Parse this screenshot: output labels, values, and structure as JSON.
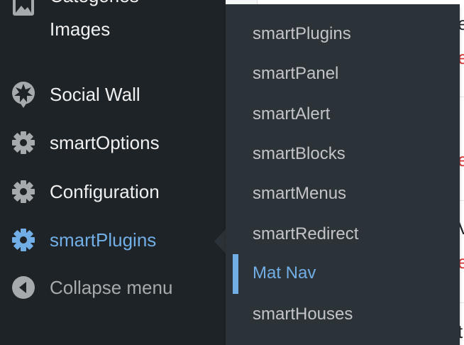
{
  "menu": {
    "categories_images": {
      "line1": "Categories",
      "line2": "Images"
    },
    "items": [
      {
        "label": "Social Wall",
        "icon": "social-wall-icon"
      },
      {
        "label": "smartOptions",
        "icon": "gear-icon"
      },
      {
        "label": "Configuration",
        "icon": "gear-icon"
      },
      {
        "label": "smartPlugins",
        "icon": "gear-icon",
        "current": true
      }
    ],
    "collapse": {
      "label": "Collapse menu",
      "icon": "collapse-arrow-icon"
    }
  },
  "submenu": {
    "items": [
      {
        "label": "smartPlugins"
      },
      {
        "label": "smartPanel"
      },
      {
        "label": "smartAlert"
      },
      {
        "label": "smartBlocks"
      },
      {
        "label": "smartMenus"
      },
      {
        "label": "smartRedirect"
      },
      {
        "label": "Mat Nav",
        "current": true
      },
      {
        "label": "smartHouses"
      }
    ]
  },
  "colors": {
    "menu_bg": "#1d2327",
    "submenu_bg": "#2c3338",
    "text": "#f0f0f1",
    "submenu_text": "#c3c4c7",
    "accent": "#72aee6",
    "muted": "#a7aaad",
    "link_red": "#d63638"
  }
}
